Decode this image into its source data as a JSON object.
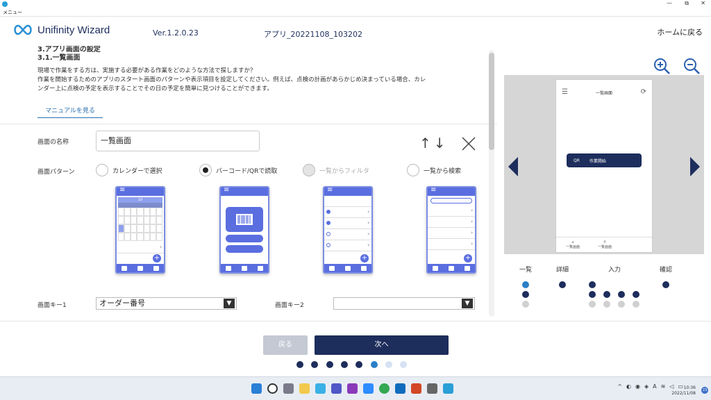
{
  "window": {
    "menu_label": "メニュー",
    "min": "—",
    "max": "⧉",
    "close": "✕"
  },
  "header": {
    "logo_text": "Unifinity Wizard",
    "version": "Ver.1.2.0.23",
    "app_name": "アプリ_20221108_103202",
    "home_link": "ホームに戻る"
  },
  "section": {
    "prev_title": "3.アプリ画面の設定",
    "title": "3.1.一覧画面",
    "desc_line1": "現場で作業をする方は、実施する必要がある作業をどのような方法で探しますか？",
    "desc_line2": "作業を開始するためのアプリのスタート画面のパターンや表示項目を設定してください。例えば、点検の計画があらかじめ決まっている場合、カレ",
    "desc_line3": "ンダー上に点検の予定を表示することでその日の予定を簡単に見つけることができます。",
    "manual_link": "マニュアルを見る"
  },
  "form": {
    "name_label": "画面の名称",
    "name_value": "一覧画面",
    "pattern_label": "画面パターン",
    "patterns": [
      {
        "label": "カレンダーで選択",
        "selected": false,
        "disabled": false
      },
      {
        "label": "バーコード/QRで読取",
        "selected": true,
        "disabled": false
      },
      {
        "label": "一覧からフィルタ",
        "selected": false,
        "disabled": true
      },
      {
        "label": "一覧から検索",
        "selected": false,
        "disabled": false
      }
    ],
    "thumb_cal_date": "10",
    "key1_label": "画面キー1",
    "key1_value": "オーダー番号",
    "key2_label": "画面キー2",
    "key2_value": "",
    "move_arrows": "↑↓"
  },
  "preview": {
    "title": "一覧画面",
    "button_icon": "QR",
    "button_label": "作業開始",
    "footer_items": [
      "一覧画面",
      "一覧画面"
    ]
  },
  "steps": {
    "labels": [
      "一覧",
      "詳細",
      "入力",
      "確認"
    ]
  },
  "footer": {
    "back_label": "戻る",
    "next_label": "次へ",
    "page_index": 5,
    "page_count": 8
  },
  "taskbar": {
    "time": "10:36",
    "date": "2022/11/08",
    "ime": "A",
    "notif_count": "23"
  },
  "colors": {
    "brand_dark": "#1d2d5c",
    "accent": "#5a6ee0",
    "active_blue": "#2a7fc6"
  }
}
